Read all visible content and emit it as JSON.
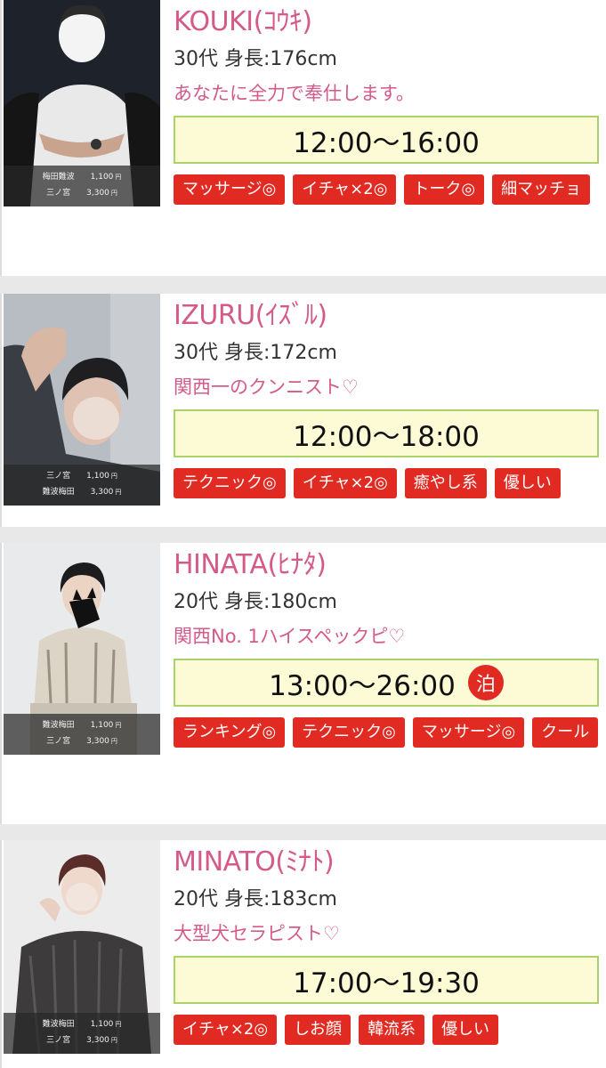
{
  "therapists": [
    {
      "name": "KOUKI(ｺｳｷ)",
      "age": "30代",
      "height": "身長:176cm",
      "catchphrase": "あなたに全力で奉仕します。",
      "hours": "12:00〜16:00",
      "stay_badge": "",
      "prices": [
        {
          "area": "梅田難波",
          "price": "1,100",
          "unit": "円"
        },
        {
          "area": "三ノ宮",
          "price": "3,300",
          "unit": "円"
        }
      ],
      "tags": [
        "マッサージ◎",
        "イチャ×2◎",
        "トーク◎",
        "細マッチョ"
      ]
    },
    {
      "name": "IZURU(ｲｽﾞﾙ)",
      "age": "30代",
      "height": "身長:172cm",
      "catchphrase": "関西一のクンニスト♡",
      "hours": "12:00〜18:00",
      "stay_badge": "",
      "prices": [
        {
          "area": "三ノ宮",
          "price": "1,100",
          "unit": "円"
        },
        {
          "area": "難波梅田",
          "price": "3,300",
          "unit": "円"
        }
      ],
      "tags": [
        "テクニック◎",
        "イチャ×2◎",
        "癒やし系",
        "優しい"
      ]
    },
    {
      "name": "HINATA(ﾋﾅﾀ)",
      "age": "20代",
      "height": "身長:180cm",
      "catchphrase": "関西No. 1ハイスペックピ♡",
      "hours": "13:00〜26:00",
      "stay_badge": "泊",
      "prices": [
        {
          "area": "難波梅田",
          "price": "1,100",
          "unit": "円"
        },
        {
          "area": "三ノ宮",
          "price": "3,300",
          "unit": "円"
        }
      ],
      "tags": [
        "ランキング◎",
        "テクニック◎",
        "マッサージ◎",
        "クール"
      ]
    },
    {
      "name": "MINATO(ﾐﾅﾄ)",
      "age": "20代",
      "height": "身長:183cm",
      "catchphrase": "大型犬セラピスト♡",
      "hours": "17:00〜19:30",
      "stay_badge": "",
      "prices": [
        {
          "area": "難波梅田",
          "price": "1,100",
          "unit": "円"
        },
        {
          "area": "三ノ宮",
          "price": "3,300",
          "unit": "円"
        }
      ],
      "tags": [
        "イチャ×2◎",
        "しお顔",
        "韓流系",
        "優しい"
      ]
    }
  ],
  "colors": {
    "accent_pink": "#d45a8a",
    "tag_red": "#e12b22",
    "hours_bg": "#fdfbd6",
    "hours_border": "#a9d36a"
  }
}
